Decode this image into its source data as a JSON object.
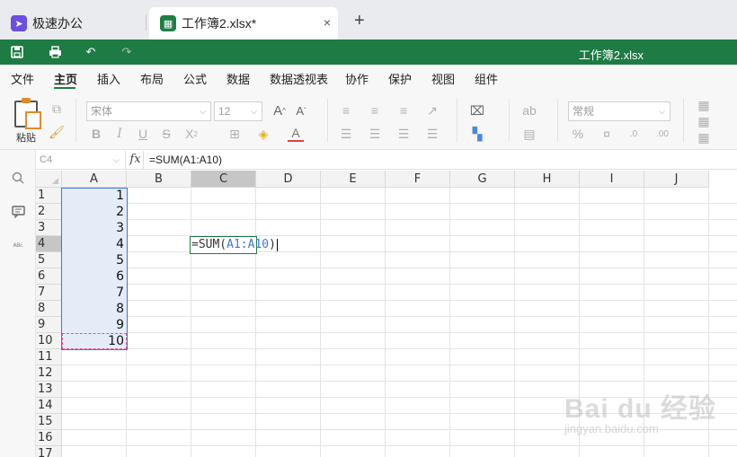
{
  "tabs": [
    {
      "label": "极速办公",
      "icon": "rocket-icon"
    },
    {
      "label": "工作簿2.xlsx*",
      "icon": "spreadsheet-icon",
      "close": "×"
    }
  ],
  "new_tab": "+",
  "quickbar": {
    "doc_title": "工作簿2.xlsx"
  },
  "menu": [
    "文件",
    "主页",
    "插入",
    "布局",
    "公式",
    "数据",
    "数据透视表",
    "协作",
    "保护",
    "视图",
    "组件"
  ],
  "active_menu": "主页",
  "ribbon": {
    "paste_label": "粘贴",
    "font_name": "宋体",
    "font_size": "12",
    "number_format": "常规"
  },
  "formula_bar": {
    "name_box": "C4",
    "fx": "fx",
    "formula": "=SUM(A1:A10)"
  },
  "columns": [
    "A",
    "B",
    "C",
    "D",
    "E",
    "F",
    "G",
    "H",
    "I",
    "J"
  ],
  "selected_column": "C",
  "rows": [
    "1",
    "2",
    "3",
    "4",
    "5",
    "6",
    "7",
    "8",
    "9",
    "10",
    "11",
    "12",
    "13",
    "14",
    "15",
    "16",
    "17"
  ],
  "selected_row": "4",
  "cells_A": [
    "1",
    "2",
    "3",
    "4",
    "5",
    "6",
    "7",
    "8",
    "9",
    "10"
  ],
  "editing_cell": {
    "prefix": "=SUM(",
    "ref": "A1:A10",
    "suffix": ")"
  },
  "watermark": {
    "logo": "Bai du 经验",
    "url": "jingyan.baidu.com"
  },
  "colors": {
    "brand_green": "#1d7b43",
    "range_blue": "#3c78d8",
    "app_purple": "#6b4fe0"
  }
}
